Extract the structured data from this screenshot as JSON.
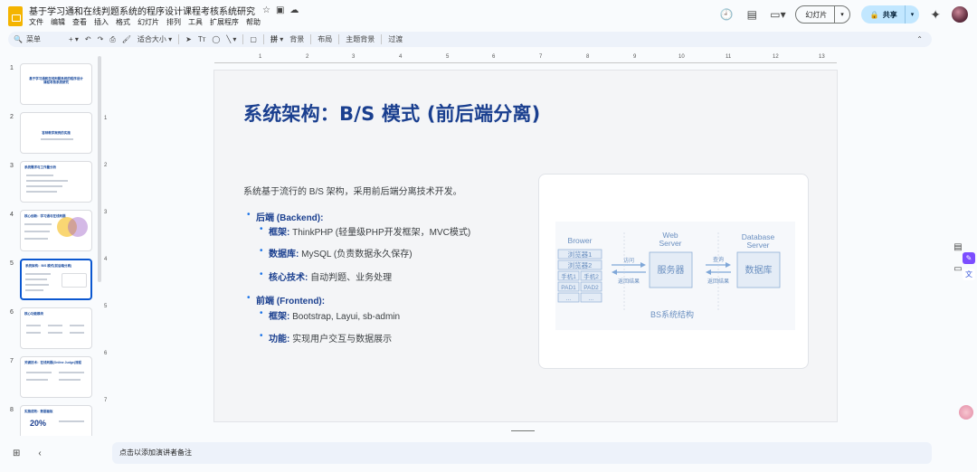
{
  "doc": {
    "title": "基于学习通和在线判题系统的程序设计课程考核系统研究",
    "menu": [
      "文件",
      "编辑",
      "查看",
      "插入",
      "格式",
      "幻灯片",
      "排列",
      "工具",
      "扩展程序",
      "帮助"
    ]
  },
  "header": {
    "slideshow_label": "幻灯片",
    "share_label": "共享"
  },
  "toolbar": {
    "search_label": "菜单",
    "zoom_label": "适合大小",
    "arrange_label": "拼",
    "background_label": "背景",
    "layout_label": "布局",
    "theme_label": "主题背景",
    "transition_label": "过渡"
  },
  "filmstrip": {
    "slides": [
      {
        "num": "1",
        "title": "基于学习通和在线判题系统的程序设计课程考核系统研究"
      },
      {
        "num": "2",
        "title": "答辩教学案例的实施"
      },
      {
        "num": "3",
        "title": "系统需求与工作量分析"
      },
      {
        "num": "4",
        "title": "核心创新：学习通与在线判题"
      },
      {
        "num": "5",
        "title": "系统架构：B/S 模式(前后端分离)"
      },
      {
        "num": "6",
        "title": "核心功能模块"
      },
      {
        "num": "7",
        "title": "关键技术：在线判题(Online Judge)流程"
      },
      {
        "num": "8",
        "title": "实施成效：数据看板"
      }
    ],
    "slide8_stat": "20%"
  },
  "ruler": {
    "h_numbers": [
      "1",
      "2",
      "3",
      "4",
      "5",
      "6",
      "7",
      "8",
      "9",
      "10",
      "11",
      "12",
      "13"
    ],
    "v_numbers": [
      "1",
      "2",
      "3",
      "4",
      "5",
      "6",
      "7"
    ]
  },
  "slide": {
    "title": "系统架构：B/S 模式 (前后端分离)",
    "intro": "系统基于流行的 B/S 架构，采用前后端分离技术开发。",
    "backend_heading": "后端 (Backend):",
    "backend_items": [
      {
        "label": "框架:",
        "text": " ThinkPHP (轻量级PHP开发框架，MVC模式)"
      },
      {
        "label": "数据库:",
        "text": " MySQL (负责数据永久保存)"
      },
      {
        "label": "核心技术:",
        "text": " 自动判题、业务处理"
      }
    ],
    "frontend_heading": "前端 (Frontend):",
    "frontend_items": [
      {
        "label": "框架:",
        "text": " Bootstrap, Layui, sb-admin"
      },
      {
        "label": "功能:",
        "text": " 实现用户交互与数据展示"
      }
    ],
    "diagram": {
      "browser_label": "Brower",
      "browser_cells": [
        "浏览器1",
        "浏览器2",
        "手机1",
        "手机2",
        "PAD1",
        "PAD2",
        "...",
        "..."
      ],
      "arrow1_top": "访问",
      "arrow1_bottom": "返回结果",
      "web_label_1": "Web",
      "web_label_2": "Server",
      "server_box": "服务器",
      "arrow2_top": "查询",
      "arrow2_bottom": "返回结果",
      "db_label_1": "Database",
      "db_label_2": "Server",
      "db_box": "数据库",
      "caption": "BS系统结构"
    }
  },
  "notes": {
    "placeholder": "点击以添加演讲者备注"
  },
  "colors": {
    "accent": "#0b57d0",
    "title_blue": "#1a3f8f",
    "share_bg": "#c2e7ff"
  }
}
